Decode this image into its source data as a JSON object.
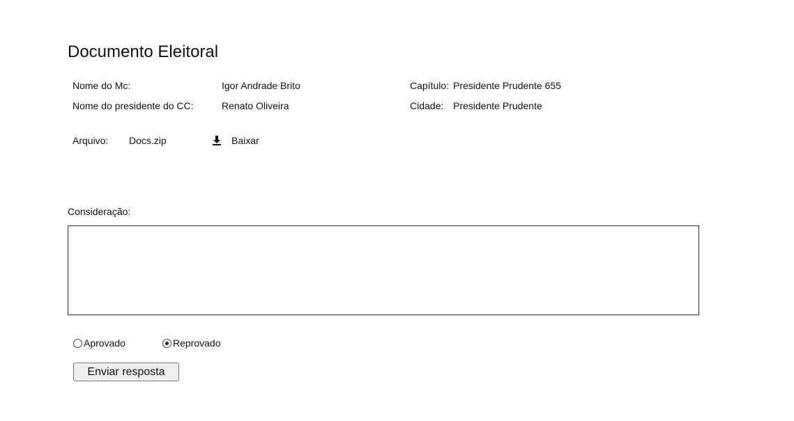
{
  "title": "Documento Eleitoral",
  "info": {
    "mc_name_label": "Nome do Mc:",
    "mc_name_value": "Igor Andrade Brito",
    "cc_president_label": "Nome do presidente do CC:",
    "cc_president_value": "Renato Oliveira",
    "chapter_label": "Capítulo:",
    "chapter_value": "Presidente Prudente 655",
    "city_label": "Cidade:",
    "city_value": "Presidente Prudente"
  },
  "file": {
    "label": "Arquivo:",
    "name": "Docs.zip",
    "download_label": "Baixar",
    "download_icon": "download-icon"
  },
  "consideration": {
    "label": "Consideração:",
    "value": ""
  },
  "decision": {
    "options": [
      {
        "label": "Aprovado",
        "checked": false
      },
      {
        "label": "Reprovado",
        "checked": true
      }
    ]
  },
  "submit_label": "Enviar resposta"
}
